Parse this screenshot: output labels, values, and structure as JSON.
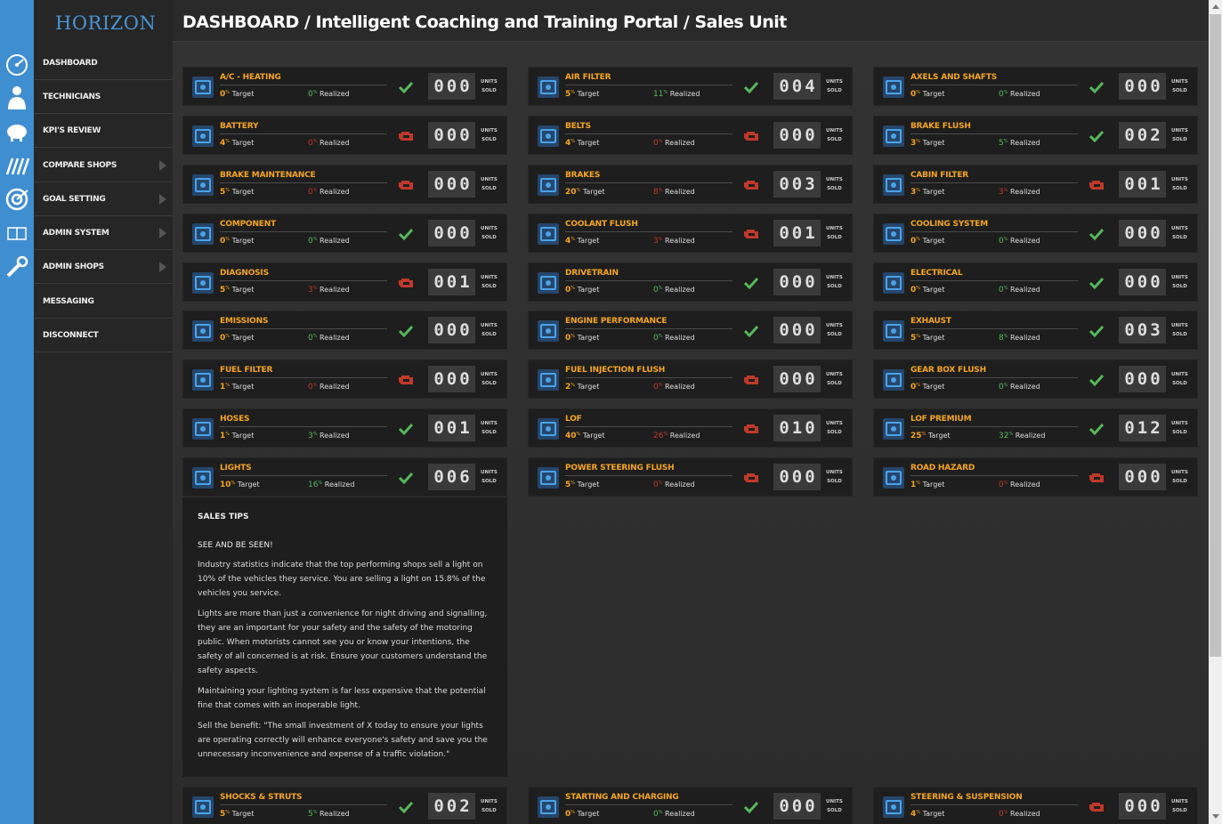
{
  "brand": "HORIZON",
  "header": "DASHBOARD / Intelligent Coaching and Training Portal / Sales Unit",
  "nav": [
    {
      "label": "DASHBOARD",
      "icon": "dashboard-gauge-icon",
      "arrow": false
    },
    {
      "label": "TECHNICIANS",
      "icon": "technician-icon",
      "arrow": false
    },
    {
      "label": "KPI'S REVIEW",
      "icon": "piggy-bank-icon",
      "arrow": false
    },
    {
      "label": "COMPARE SHOPS",
      "icon": "compare-bars-icon",
      "arrow": true
    },
    {
      "label": "GOAL SETTING",
      "icon": "target-icon",
      "arrow": true
    },
    {
      "label": "ADMIN SYSTEM",
      "icon": "admin-book-icon",
      "arrow": true
    },
    {
      "label": "ADMIN SHOPS",
      "icon": "wrench-icon",
      "arrow": true
    },
    {
      "label": "MESSAGING",
      "icon": "",
      "arrow": false
    },
    {
      "label": "DISCONNECT",
      "icon": "",
      "arrow": false
    }
  ],
  "labels": {
    "target": "Target",
    "realized": "Realized",
    "units": "UNITS",
    "sold": "SOLD",
    "pct": "%"
  },
  "cards": [
    {
      "title": "A/C - HEATING",
      "target": "0",
      "realized": "0",
      "units": "000",
      "status": "ok",
      "icon": "ac-heating-icon"
    },
    {
      "title": "AIR FILTER",
      "target": "5",
      "realized": "11",
      "units": "004",
      "status": "ok",
      "icon": "air-filter-icon"
    },
    {
      "title": "AXELS AND SHAFTS",
      "target": "0",
      "realized": "0",
      "units": "000",
      "status": "ok",
      "icon": "axle-icon"
    },
    {
      "title": "BATTERY",
      "target": "4",
      "realized": "0",
      "units": "000",
      "status": "warn",
      "icon": "battery-icon"
    },
    {
      "title": "BELTS",
      "target": "4",
      "realized": "0",
      "units": "000",
      "status": "warn",
      "icon": "belts-icon"
    },
    {
      "title": "BRAKE FLUSH",
      "target": "3",
      "realized": "5",
      "units": "002",
      "status": "ok",
      "icon": "brake-flush-icon"
    },
    {
      "title": "BRAKE MAINTENANCE",
      "target": "5",
      "realized": "0",
      "units": "000",
      "status": "warn",
      "icon": "brake-maintenance-icon"
    },
    {
      "title": "BRAKES",
      "target": "20",
      "realized": "8",
      "units": "003",
      "status": "warn",
      "icon": "brakes-icon"
    },
    {
      "title": "CABIN FILTER",
      "target": "3",
      "realized": "3",
      "units": "001",
      "status": "warn",
      "icon": "cabin-filter-icon"
    },
    {
      "title": "COMPONENT",
      "target": "0",
      "realized": "0",
      "units": "000",
      "status": "ok",
      "icon": "component-icon"
    },
    {
      "title": "COOLANT FLUSH",
      "target": "4",
      "realized": "3",
      "units": "001",
      "status": "warn",
      "icon": "coolant-flush-icon"
    },
    {
      "title": "COOLING SYSTEM",
      "target": "0",
      "realized": "0",
      "units": "000",
      "status": "ok",
      "icon": "cooling-system-icon"
    },
    {
      "title": "DIAGNOSIS",
      "target": "5",
      "realized": "3",
      "units": "001",
      "status": "warn",
      "icon": "diagnosis-icon"
    },
    {
      "title": "DRIVETRAIN",
      "target": "0",
      "realized": "0",
      "units": "000",
      "status": "ok",
      "icon": "drivetrain-icon"
    },
    {
      "title": "ELECTRICAL",
      "target": "0",
      "realized": "0",
      "units": "000",
      "status": "ok",
      "icon": "electrical-icon"
    },
    {
      "title": "EMISSIONS",
      "target": "0",
      "realized": "0",
      "units": "000",
      "status": "ok",
      "icon": "emissions-icon"
    },
    {
      "title": "ENGINE PERFORMANCE",
      "target": "0",
      "realized": "0",
      "units": "000",
      "status": "ok",
      "icon": "engine-icon"
    },
    {
      "title": "EXHAUST",
      "target": "5",
      "realized": "8",
      "units": "003",
      "status": "ok",
      "icon": "exhaust-icon"
    },
    {
      "title": "FUEL FILTER",
      "target": "1",
      "realized": "0",
      "units": "000",
      "status": "warn",
      "icon": "fuel-filter-icon"
    },
    {
      "title": "FUEL INJECTION FLUSH",
      "target": "2",
      "realized": "0",
      "units": "000",
      "status": "warn",
      "icon": "fuel-injection-icon"
    },
    {
      "title": "GEAR BOX FLUSH",
      "target": "0",
      "realized": "0",
      "units": "000",
      "status": "ok",
      "icon": "gearbox-flush-icon"
    },
    {
      "title": "HOSES",
      "target": "1",
      "realized": "3",
      "units": "001",
      "status": "ok",
      "icon": "hoses-icon"
    },
    {
      "title": "LOF",
      "target": "40",
      "realized": "26",
      "units": "010",
      "status": "warn",
      "icon": "oil-drop-icon"
    },
    {
      "title": "LOF PREMIUM",
      "target": "25",
      "realized": "32",
      "units": "012",
      "status": "ok",
      "icon": "oil-premium-icon"
    },
    {
      "title": "LIGHTS",
      "target": "10",
      "realized": "16",
      "units": "006",
      "status": "ok",
      "icon": "headlight-icon"
    },
    {
      "title": "POWER STEERING FLUSH",
      "target": "5",
      "realized": "0",
      "units": "000",
      "status": "warn",
      "icon": "steering-wheel-icon"
    },
    {
      "title": "ROAD HAZARD",
      "target": "1",
      "realized": "0",
      "units": "000",
      "status": "warn",
      "icon": "road-hazard-icon"
    },
    {
      "title": "SHOCKS & STRUTS",
      "target": "5",
      "realized": "5",
      "units": "002",
      "status": "ok",
      "icon": "shocks-icon"
    },
    {
      "title": "STARTING AND CHARGING",
      "target": "0",
      "realized": "0",
      "units": "000",
      "status": "ok",
      "icon": "starting-charging-icon"
    },
    {
      "title": "STEERING & SUSPENSION",
      "target": "4",
      "realized": "0",
      "units": "000",
      "status": "warn",
      "icon": "steering-suspension-icon"
    }
  ],
  "tips": {
    "heading": "SALES TIPS",
    "subheading": "SEE AND BE SEEN!",
    "paragraphs": [
      "Industry statistics indicate that the top performing shops sell a light on 10% of the vehicles they service. You are selling a light on 15.8% of the vehicles you service.",
      "Lights are more than just a convenience for night driving and signalling, they are an important for your safety and the safety of the motoring public. When motorists cannot see you or know your intentions, the safety of all concerned is at risk. Ensure your customers understand the safety aspects.",
      "Maintaining your lighting system is far less expensive that the potential fine that comes with an inoperable light.",
      "Sell the benefit: \"The small investment of X today to ensure your lights are operating correctly will enhance everyone's safety and save you the unnecessary inconvenience and expense of a traffic violation.\""
    ]
  },
  "colors": {
    "accent": "#f5a623",
    "ok": "#57b85c",
    "warn": "#c0392b",
    "sidebar": "#3f8ed0"
  }
}
